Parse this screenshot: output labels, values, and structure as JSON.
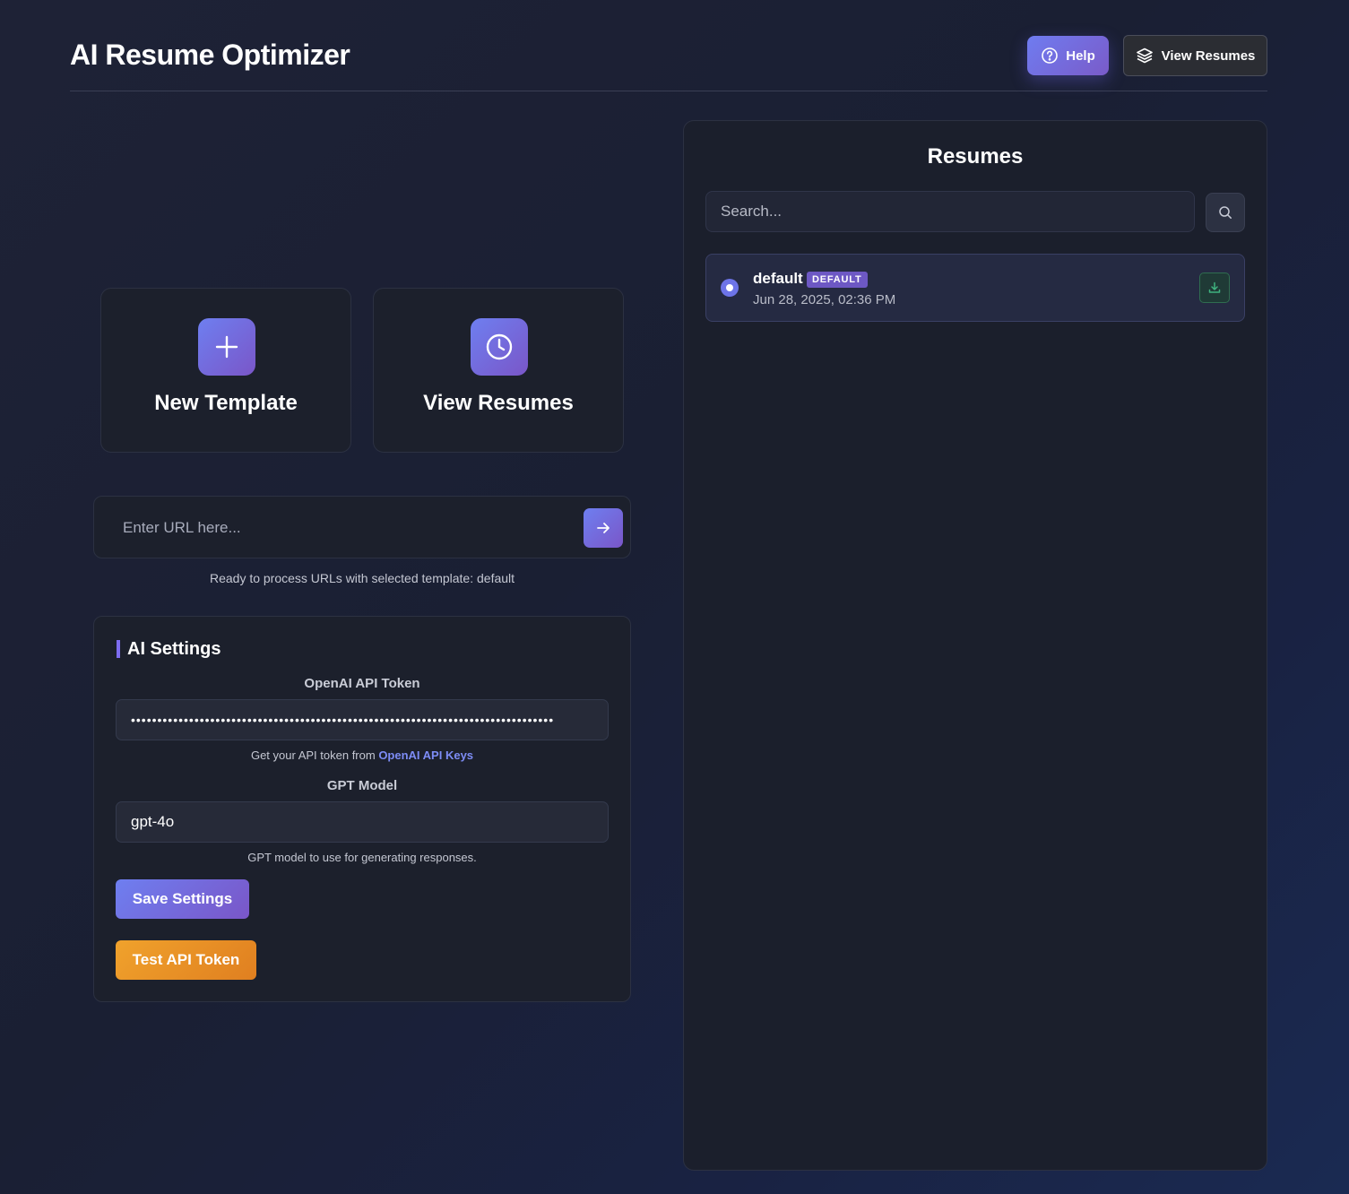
{
  "header": {
    "title": "AI Resume Optimizer",
    "help_label": "Help",
    "view_resumes_label": "View Resumes"
  },
  "actions": {
    "new_template_label": "New Template",
    "view_resumes_label": "View Resumes"
  },
  "url": {
    "placeholder": "Enter URL here...",
    "status": "Ready to process URLs with selected template: default"
  },
  "settings": {
    "title": "AI Settings",
    "token_label": "OpenAI API Token",
    "token_value": "••••••••••••••••••••••••••••••••••••••••••••••••••••••••••••••••••••••••••••••••",
    "token_help_prefix": "Get your API token from ",
    "token_help_link": "OpenAI API Keys",
    "model_label": "GPT Model",
    "model_value": "gpt-4o",
    "model_help": "GPT model to use for generating responses.",
    "save_label": "Save Settings",
    "test_label": "Test API Token"
  },
  "resumes": {
    "title": "Resumes",
    "search_placeholder": "Search...",
    "items": [
      {
        "name": "default",
        "badge": "DEFAULT",
        "date": "Jun 28, 2025, 02:36 PM",
        "selected": true
      }
    ]
  },
  "colors": {
    "accent_gradient_start": "#6e7ff0",
    "accent_gradient_end": "#7a56c8",
    "test_button": "#f0a22c",
    "link": "#7d8cf5",
    "download_icon": "#3fb27f"
  },
  "icons": {
    "help": "question-circle-icon",
    "view_resumes": "layers-icon",
    "new_template": "plus-icon",
    "history": "clock-icon",
    "go": "arrow-right-icon",
    "search": "search-icon",
    "download": "download-icon"
  }
}
